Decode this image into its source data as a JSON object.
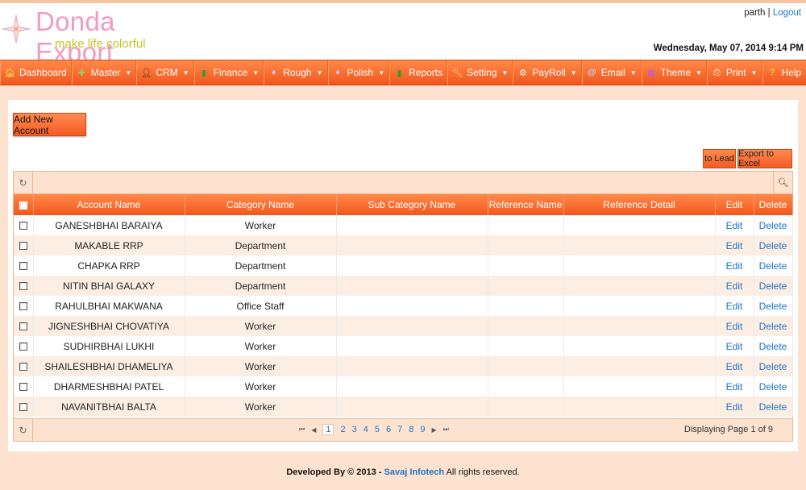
{
  "header": {
    "brand": "Donda Export",
    "tagline": "make life colorful",
    "username": "parth",
    "separator": "|",
    "logout_label": "Logout",
    "datetime": "Wednesday, May 07, 2014 9:14 PM"
  },
  "menu": [
    {
      "label": "Dashboard",
      "icon": "home-icon",
      "has_caret": false
    },
    {
      "label": "Master",
      "icon": "plus-icon",
      "has_caret": true
    },
    {
      "label": "CRM",
      "icon": "person-icon",
      "has_caret": true
    },
    {
      "label": "Finance",
      "icon": "bar-chart-icon",
      "has_caret": true
    },
    {
      "label": "Rough",
      "icon": "diamond-icon",
      "has_caret": true
    },
    {
      "label": "Polish",
      "icon": "diamond-icon",
      "has_caret": true
    },
    {
      "label": "Reports",
      "icon": "bar-chart-icon",
      "has_caret": false
    },
    {
      "label": "Setting",
      "icon": "wrench-icon",
      "has_caret": true
    },
    {
      "label": "PayRoll",
      "icon": "gear-icon",
      "has_caret": true
    },
    {
      "label": "Email",
      "icon": "at-icon",
      "has_caret": true
    },
    {
      "label": "Theme",
      "icon": "palette-icon",
      "has_caret": true
    },
    {
      "label": "Print",
      "icon": "printer-icon",
      "has_caret": true
    },
    {
      "label": "Help",
      "icon": "question-icon",
      "has_caret": true
    }
  ],
  "actions": {
    "add_new_account": "Add New Account",
    "to_lead": "to Lead",
    "export_excel": "Export to Excel"
  },
  "grid": {
    "columns": [
      "Account Name",
      "Category Name",
      "Sub Category Name",
      "Reference Name",
      "Reference Detail",
      "Edit",
      "Delete"
    ],
    "rows": [
      {
        "account": "GANESHBHAI BARAIYA",
        "category": "Worker",
        "sub_category": "",
        "ref_name": "",
        "ref_detail": "",
        "edit": "Edit",
        "delete": "Delete"
      },
      {
        "account": "MAKABLE RRP",
        "category": "Department",
        "sub_category": "",
        "ref_name": "",
        "ref_detail": "",
        "edit": "Edit",
        "delete": "Delete"
      },
      {
        "account": "CHAPKA RRP",
        "category": "Department",
        "sub_category": "",
        "ref_name": "",
        "ref_detail": "",
        "edit": "Edit",
        "delete": "Delete"
      },
      {
        "account": "NITIN BHAI GALAXY",
        "category": "Department",
        "sub_category": "",
        "ref_name": "",
        "ref_detail": "",
        "edit": "Edit",
        "delete": "Delete"
      },
      {
        "account": "RAHULBHAI MAKWANA",
        "category": "Office Staff",
        "sub_category": "",
        "ref_name": "",
        "ref_detail": "",
        "edit": "Edit",
        "delete": "Delete"
      },
      {
        "account": "JIGNESHBHAI CHOVATIYA",
        "category": "Worker",
        "sub_category": "",
        "ref_name": "",
        "ref_detail": "",
        "edit": "Edit",
        "delete": "Delete"
      },
      {
        "account": "SUDHIRBHAI LUKHI",
        "category": "Worker",
        "sub_category": "",
        "ref_name": "",
        "ref_detail": "",
        "edit": "Edit",
        "delete": "Delete"
      },
      {
        "account": "SHAILESHBHAI DHAMELIYA",
        "category": "Worker",
        "sub_category": "",
        "ref_name": "",
        "ref_detail": "",
        "edit": "Edit",
        "delete": "Delete"
      },
      {
        "account": "DHARMESHBHAI PATEL",
        "category": "Worker",
        "sub_category": "",
        "ref_name": "",
        "ref_detail": "",
        "edit": "Edit",
        "delete": "Delete"
      },
      {
        "account": "NAVANITBHAI BALTA",
        "category": "Worker",
        "sub_category": "",
        "ref_name": "",
        "ref_detail": "",
        "edit": "Edit",
        "delete": "Delete"
      }
    ],
    "pager": {
      "pages": [
        "1",
        "2",
        "3",
        "4",
        "5",
        "6",
        "7",
        "8",
        "9"
      ],
      "current": "1",
      "displaying": "Displaying Page 1 of 9"
    }
  },
  "footer": {
    "prefix": "Developed By © 2013 - ",
    "company": "Savaj Infotech",
    "suffix": " All rights reserved."
  },
  "colors": {
    "accent": "#f2561c",
    "page_bg": "#fde3cf",
    "link": "#1e73c9",
    "brand": "#f29ac3",
    "tagline": "#c7c42a"
  }
}
